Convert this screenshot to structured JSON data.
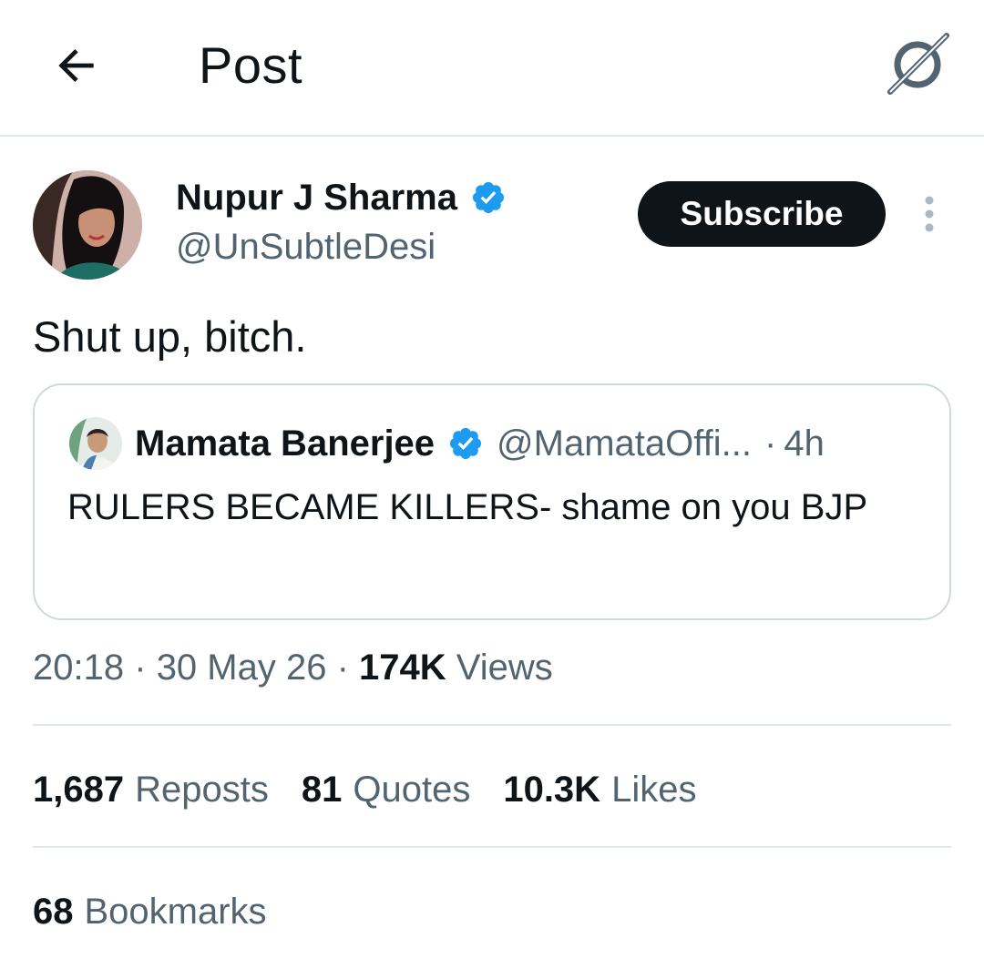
{
  "header": {
    "title": "Post",
    "back_icon": "arrow-left-icon",
    "grok_icon": "grok-icon"
  },
  "post": {
    "author": {
      "name": "Nupur J Sharma",
      "handle": "@UnSubtleDesi",
      "verified": true
    },
    "subscribe_label": "Subscribe",
    "text": "Shut up, bitch.",
    "quoted": {
      "name": "Mamata Banerjee",
      "handle": "@MamataOffi...",
      "separator": "·",
      "time": "4h",
      "text": "RULERS BECAME KILLERS- shame on you BJP",
      "verified": true
    },
    "meta": {
      "time": "20:18",
      "sep1": "·",
      "date": "30 May 26",
      "sep2": "·",
      "views_count": "174K",
      "views_label": "Views"
    },
    "stats": {
      "reposts_count": "1,687",
      "reposts_label": "Reposts",
      "quotes_count": "81",
      "quotes_label": "Quotes",
      "likes_count": "10.3K",
      "likes_label": "Likes",
      "bookmarks_count": "68",
      "bookmarks_label": "Bookmarks"
    }
  },
  "colors": {
    "text_primary": "#0f1419",
    "text_secondary": "#536471",
    "verified_blue": "#1d9bf0",
    "border": "#cfd9de",
    "divider": "#e1e8ed",
    "button_bg": "#0f1419"
  }
}
